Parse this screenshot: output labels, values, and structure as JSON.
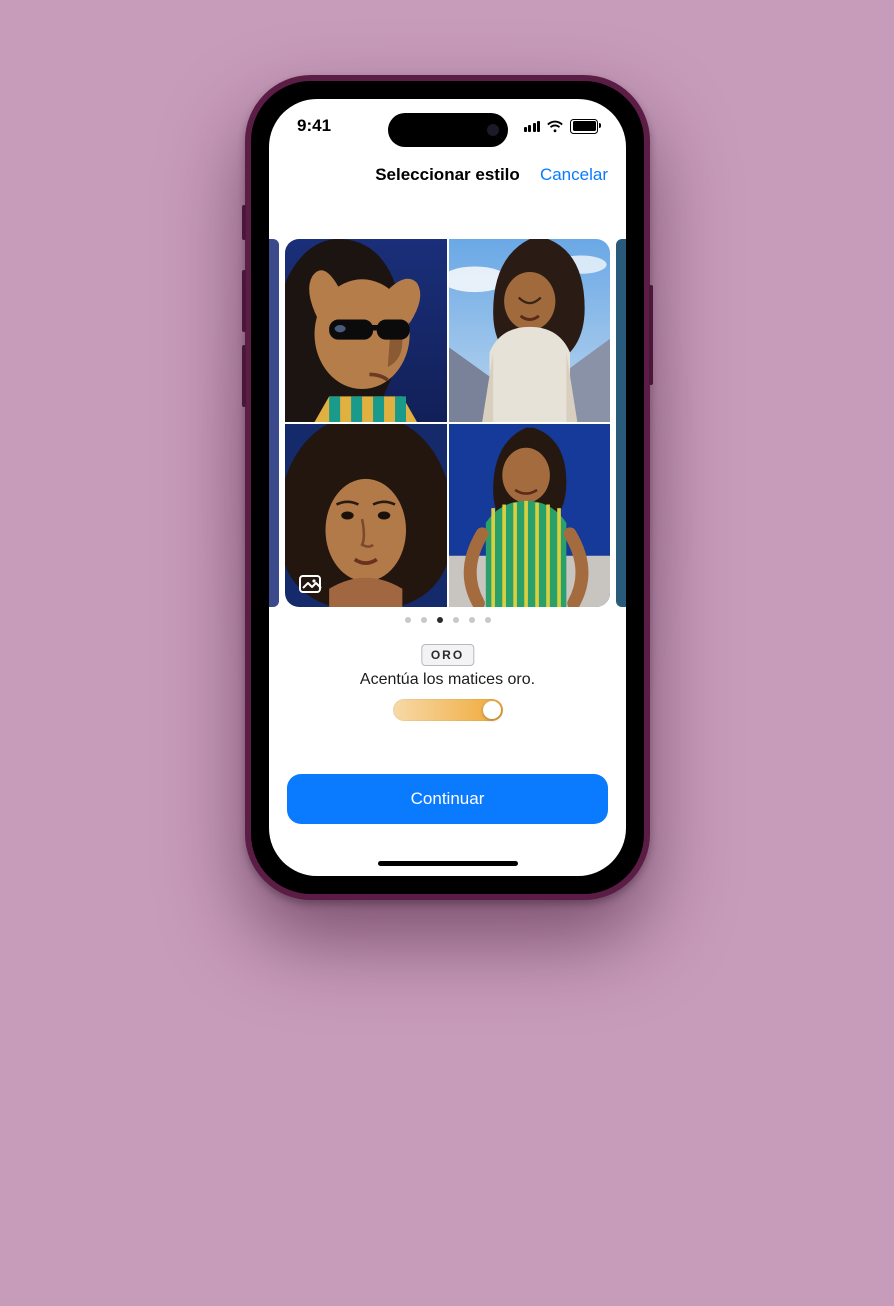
{
  "status": {
    "time": "9:41"
  },
  "nav": {
    "title": "Seleccionar estilo",
    "cancel": "Cancelar"
  },
  "carousel": {
    "page_count": 6,
    "active_index": 2
  },
  "style": {
    "name": "ORO",
    "description": "Acentúa los matices oro."
  },
  "actions": {
    "primary": "Continuar"
  }
}
